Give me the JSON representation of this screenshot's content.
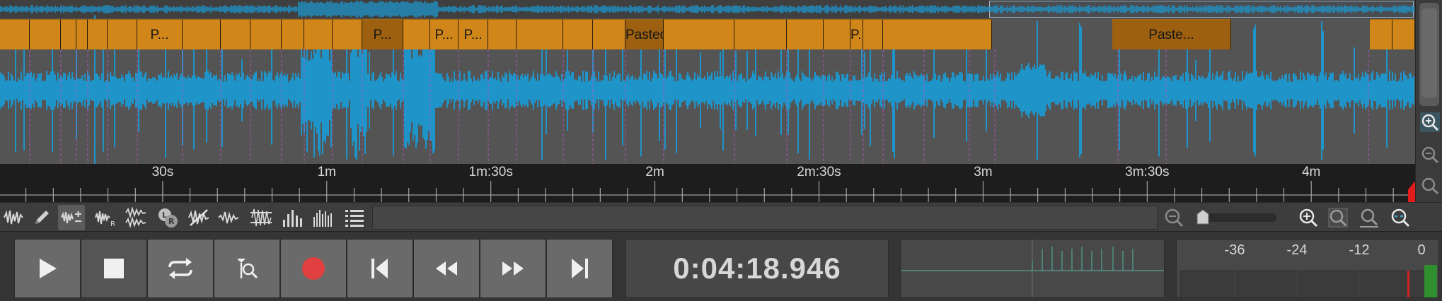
{
  "editor": {
    "colors": {
      "waveform": "#1e94c9",
      "clip": "#d1861a",
      "clip_selected": "#9c6010",
      "marker": "#c454c4",
      "background": "#545454"
    },
    "clips": [
      {
        "label": ""
      },
      {
        "label": ""
      },
      {
        "label": ""
      },
      {
        "label": ""
      },
      {
        "label": ""
      },
      {
        "label": ""
      },
      {
        "label": "P..."
      },
      {
        "label": ""
      },
      {
        "label": ""
      },
      {
        "label": ""
      },
      {
        "label": ""
      },
      {
        "label": ""
      },
      {
        "label": ""
      },
      {
        "label": "P...",
        "selected": true
      },
      {
        "label": ""
      },
      {
        "label": "P..."
      },
      {
        "label": "P..."
      },
      {
        "label": ""
      },
      {
        "label": ""
      },
      {
        "label": ""
      },
      {
        "label": ""
      },
      {
        "label": "Pasted...",
        "selected": true
      },
      {
        "label": ""
      },
      {
        "label": ""
      },
      {
        "label": ""
      },
      {
        "label": ""
      },
      {
        "label": "P..."
      },
      {
        "label": ""
      },
      {
        "label": ""
      },
      {
        "label": "Paste...",
        "selected": true
      },
      {
        "label": ""
      },
      {
        "label": ""
      }
    ],
    "ruler": {
      "labels": [
        "30s",
        "1m",
        "1m:30s",
        "2m",
        "2m:30s",
        "3m",
        "3m:30s",
        "4m"
      ],
      "label_seconds": [
        30,
        60,
        90,
        120,
        150,
        180,
        210,
        240
      ],
      "minor_tick_seconds": 5
    }
  },
  "zoom_column": {
    "buttons": [
      {
        "name": "zoom-in-vertical-icon",
        "active": true
      },
      {
        "name": "zoom-out-vertical-icon",
        "active": false
      },
      {
        "name": "zoom-fit-vertical-icon",
        "active": false
      }
    ]
  },
  "tools": [
    {
      "name": "waveform-tool-icon",
      "active": false
    },
    {
      "name": "pencil-tool-icon",
      "active": false
    },
    {
      "name": "gain-tool-icon",
      "active": true
    },
    {
      "name": "effect-r-tool-icon",
      "active": false
    },
    {
      "name": "multi-effect-tool-icon",
      "active": false
    },
    {
      "name": "left-right-channel-icon",
      "active": false
    },
    {
      "name": "no-edit-tool-icon",
      "active": false
    },
    {
      "name": "normalize-tool-icon",
      "active": false
    },
    {
      "name": "noise-tool-icon",
      "active": false
    },
    {
      "name": "spectrum-tool-icon",
      "active": false
    },
    {
      "name": "spectrogram-tool-icon",
      "active": false
    },
    {
      "name": "track-list-icon",
      "active": false
    }
  ],
  "transport": {
    "buttons": [
      {
        "name": "play-button",
        "icon": "play-icon"
      },
      {
        "name": "stop-button",
        "icon": "stop-icon",
        "active": true
      },
      {
        "name": "loop-button",
        "icon": "loop-icon"
      },
      {
        "name": "scrub-button",
        "icon": "scrub-icon"
      },
      {
        "name": "record-button",
        "icon": "record-icon"
      },
      {
        "name": "go-to-start-button",
        "icon": "skip-start-icon"
      },
      {
        "name": "rewind-button",
        "icon": "rewind-icon"
      },
      {
        "name": "fast-forward-button",
        "icon": "fast-forward-icon"
      },
      {
        "name": "go-to-end-button",
        "icon": "skip-end-icon"
      }
    ],
    "time": "0:04:18.946",
    "record_color": "#e04040"
  },
  "meter": {
    "labels": [
      "-36",
      "-24",
      "-12",
      "0"
    ],
    "peak_color": "#d02424",
    "level_color": "#2f8f2f"
  }
}
